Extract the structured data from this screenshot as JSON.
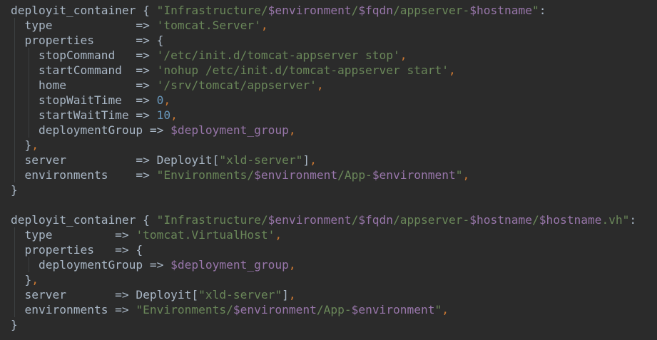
{
  "code": {
    "lines": [
      [
        [
          "plain",
          "deployit_container { "
        ],
        [
          "str",
          "\"Infrastructure/"
        ],
        [
          "var",
          "$environment"
        ],
        [
          "str",
          "/"
        ],
        [
          "var",
          "$fqdn"
        ],
        [
          "str",
          "/appserver-"
        ],
        [
          "var",
          "$hostname"
        ],
        [
          "str",
          "\""
        ],
        [
          "plain",
          ":"
        ]
      ],
      [
        [
          "plain",
          "  type            => "
        ],
        [
          "str",
          "'tomcat.Server'"
        ],
        [
          "punct",
          ","
        ]
      ],
      [
        [
          "plain",
          "  properties      => {"
        ]
      ],
      [
        [
          "plain",
          "    stopCommand   => "
        ],
        [
          "str",
          "'/etc/init.d/tomcat-appserver stop'"
        ],
        [
          "punct",
          ","
        ]
      ],
      [
        [
          "plain",
          "    startCommand  => "
        ],
        [
          "str",
          "'nohup /etc/init.d/tomcat-appserver start'"
        ],
        [
          "punct",
          ","
        ]
      ],
      [
        [
          "plain",
          "    home          => "
        ],
        [
          "str",
          "'/srv/tomcat/appserver'"
        ],
        [
          "punct",
          ","
        ]
      ],
      [
        [
          "plain",
          "    stopWaitTime  => "
        ],
        [
          "num",
          "0"
        ],
        [
          "punct",
          ","
        ]
      ],
      [
        [
          "plain",
          "    startWaitTime => "
        ],
        [
          "num",
          "10"
        ],
        [
          "punct",
          ","
        ]
      ],
      [
        [
          "plain",
          "    deploymentGroup => "
        ],
        [
          "var",
          "$deployment_group"
        ],
        [
          "punct",
          ","
        ]
      ],
      [
        [
          "plain",
          "  }"
        ],
        [
          "punct",
          ","
        ]
      ],
      [
        [
          "plain",
          "  server          => Deployit["
        ],
        [
          "str",
          "\"xld-server\""
        ],
        [
          "plain",
          "]"
        ],
        [
          "punct",
          ","
        ]
      ],
      [
        [
          "plain",
          "  environments    => "
        ],
        [
          "str",
          "\"Environments/"
        ],
        [
          "var",
          "$environment"
        ],
        [
          "str",
          "/App-"
        ],
        [
          "var",
          "$environment"
        ],
        [
          "str",
          "\""
        ],
        [
          "punct",
          ","
        ]
      ],
      [
        [
          "plain",
          "}"
        ]
      ],
      [
        [
          "plain",
          ""
        ]
      ],
      [
        [
          "plain",
          "deployit_container { "
        ],
        [
          "str",
          "\"Infrastructure/"
        ],
        [
          "var",
          "$environment"
        ],
        [
          "str",
          "/"
        ],
        [
          "var",
          "$fqdn"
        ],
        [
          "str",
          "/appserver-"
        ],
        [
          "var",
          "$hostname"
        ],
        [
          "str",
          "/"
        ],
        [
          "var",
          "$hostname"
        ],
        [
          "str",
          ".vh\""
        ],
        [
          "plain",
          ":"
        ]
      ],
      [
        [
          "plain",
          "  type         => "
        ],
        [
          "str",
          "'tomcat.VirtualHost'"
        ],
        [
          "punct",
          ","
        ]
      ],
      [
        [
          "plain",
          "  properties   => {"
        ]
      ],
      [
        [
          "plain",
          "    deploymentGroup => "
        ],
        [
          "var",
          "$deployment_group"
        ],
        [
          "punct",
          ","
        ]
      ],
      [
        [
          "plain",
          "  }"
        ],
        [
          "punct",
          ","
        ]
      ],
      [
        [
          "plain",
          "  server       => Deployit["
        ],
        [
          "str",
          "\"xld-server\""
        ],
        [
          "plain",
          "]"
        ],
        [
          "punct",
          ","
        ]
      ],
      [
        [
          "plain",
          "  environments => "
        ],
        [
          "str",
          "\"Environments/"
        ],
        [
          "var",
          "$environment"
        ],
        [
          "str",
          "/App-"
        ],
        [
          "var",
          "$environment"
        ],
        [
          "str",
          "\""
        ],
        [
          "punct",
          ","
        ]
      ],
      [
        [
          "plain",
          "}"
        ]
      ]
    ]
  },
  "colors": {
    "background": "#2b2b2b",
    "plain": "#a9b7c6",
    "string": "#6a8759",
    "variable": "#9876aa",
    "number": "#6897bb",
    "punctuation": "#cc7832"
  }
}
